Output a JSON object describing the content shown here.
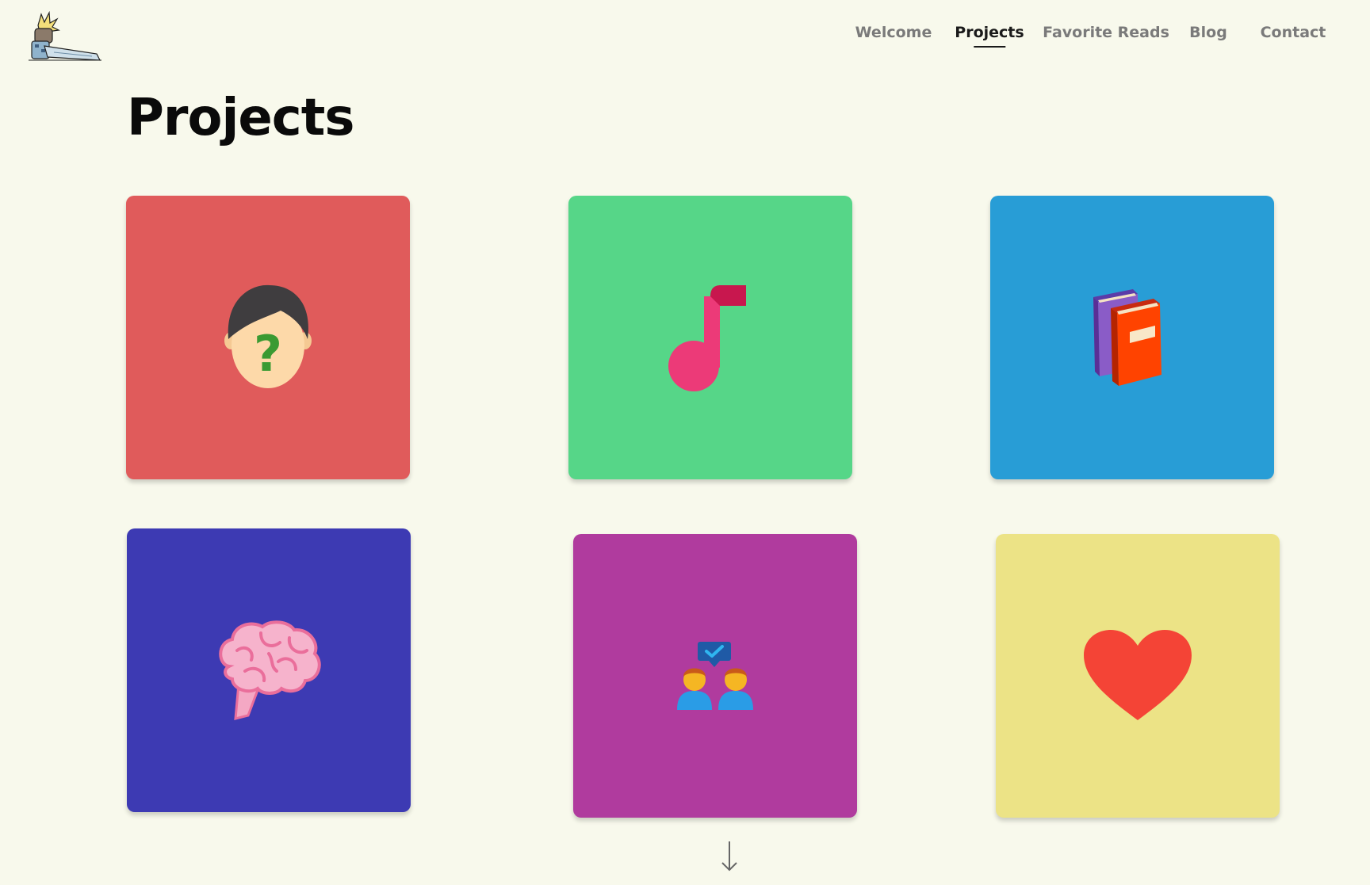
{
  "nav": {
    "items": [
      {
        "label": "Welcome",
        "active": false
      },
      {
        "label": "Projects",
        "active": true
      },
      {
        "label": "Favorite Reads",
        "active": false
      },
      {
        "label": "Blog",
        "active": false
      },
      {
        "label": "Contact",
        "active": false
      }
    ]
  },
  "page": {
    "title": "Projects"
  },
  "projects": [
    {
      "icon": "mystery-person-icon",
      "color": "#e05b5b"
    },
    {
      "icon": "music-note-icon",
      "color": "#56d688"
    },
    {
      "icon": "books-icon",
      "color": "#289dd6"
    },
    {
      "icon": "brain-icon",
      "color": "#3d3ab3"
    },
    {
      "icon": "people-chat-icon",
      "color": "#b03b9e"
    },
    {
      "icon": "heart-icon",
      "color": "#ece386"
    }
  ],
  "colors": {
    "background": "#f8f9ec",
    "text": "#0a0a0a",
    "nav_inactive": "#7a7a7a"
  },
  "scroll_hint": {
    "icon": "arrow-down-icon"
  }
}
